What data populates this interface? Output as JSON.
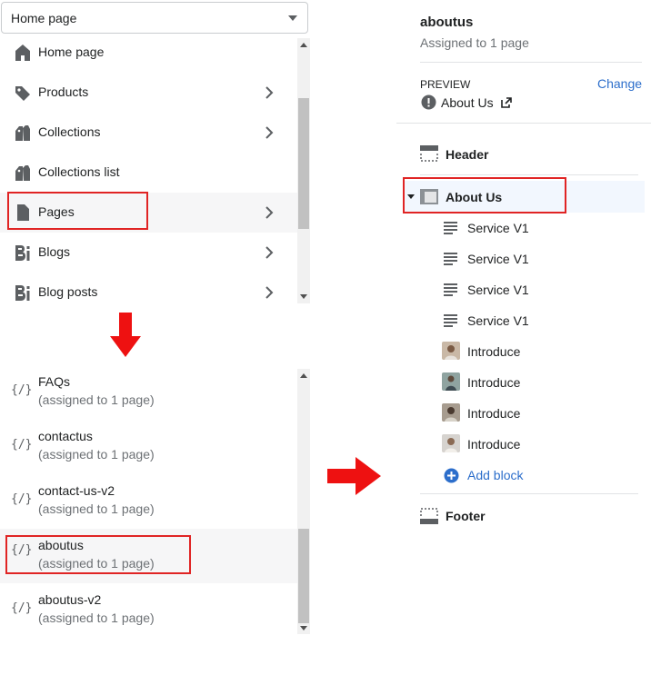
{
  "dropdown": {
    "selected": "Home page"
  },
  "menu": {
    "items": [
      {
        "label": "Home page",
        "icon": "home-icon",
        "has_chevron": false
      },
      {
        "label": "Products",
        "icon": "tag-icon",
        "has_chevron": true
      },
      {
        "label": "Collections",
        "icon": "collections-icon",
        "has_chevron": true
      },
      {
        "label": "Collections list",
        "icon": "collections-icon",
        "has_chevron": false
      },
      {
        "label": "Pages",
        "icon": "page-icon",
        "has_chevron": true
      },
      {
        "label": "Blogs",
        "icon": "blog-icon",
        "has_chevron": true
      },
      {
        "label": "Blog posts",
        "icon": "blog-icon",
        "has_chevron": true
      }
    ]
  },
  "templates": {
    "items": [
      {
        "name": "FAQs",
        "assigned": "(assigned to 1 page)"
      },
      {
        "name": "contactus",
        "assigned": "(assigned to 1 page)"
      },
      {
        "name": "contact-us-v2",
        "assigned": "(assigned to 1 page)"
      },
      {
        "name": "aboutus",
        "assigned": "(assigned to 1 page)"
      },
      {
        "name": "aboutus-v2",
        "assigned": "(assigned to 1 page)"
      }
    ],
    "icon_glyph": "{/}"
  },
  "right": {
    "title": "aboutus",
    "subtitle": "Assigned to 1 page",
    "preview_label": "PREVIEW",
    "change_link": "Change",
    "preview_page": "About Us",
    "header_label": "Header",
    "section_label": "About Us",
    "blocks": [
      {
        "label": "Service V1",
        "icon": "text-lines-icon"
      },
      {
        "label": "Service V1",
        "icon": "text-lines-icon"
      },
      {
        "label": "Service V1",
        "icon": "text-lines-icon"
      },
      {
        "label": "Service V1",
        "icon": "text-lines-icon"
      },
      {
        "label": "Introduce",
        "icon": "photo-thumbnail-icon"
      },
      {
        "label": "Introduce",
        "icon": "photo-thumbnail-icon"
      },
      {
        "label": "Introduce",
        "icon": "photo-thumbnail-icon"
      },
      {
        "label": "Introduce",
        "icon": "photo-thumbnail-icon"
      }
    ],
    "add_block": "Add block",
    "footer_label": "Footer"
  },
  "colors": {
    "accent": "#2c6ecb",
    "highlight": "#e02424",
    "selected_bg": "#f2f7fe"
  }
}
